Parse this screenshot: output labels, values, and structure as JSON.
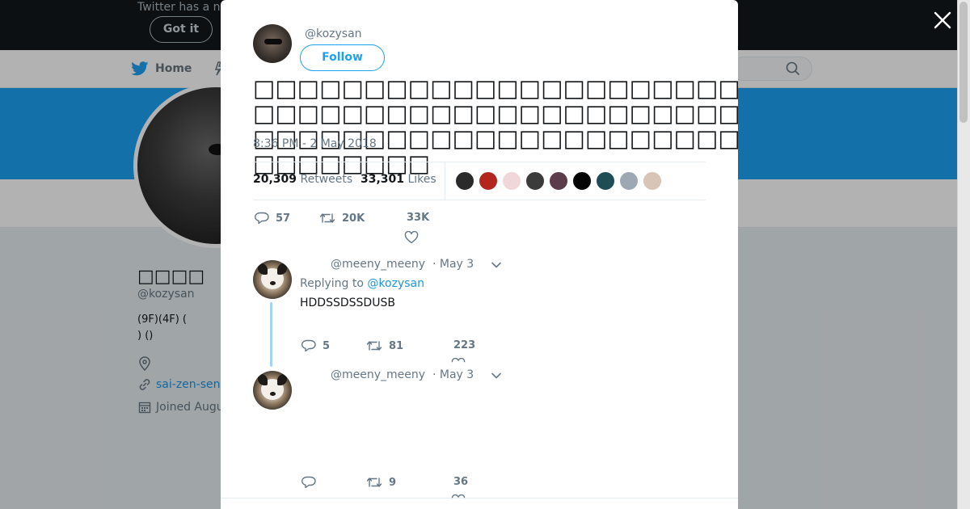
{
  "background": {
    "banner_text": "Twitter has a n",
    "got_it_label": "Got it",
    "nav_home_label": "Home",
    "profile_name": "□□□□",
    "profile_handle": "@kozysan",
    "bio_line1": "(9F)(4F) (",
    "bio_line2": ") ()",
    "website": "sai-zen-sen",
    "joined": "Joined Augu",
    "brand_color": "#1da1f2"
  },
  "modal": {
    "author": {
      "handle": "@kozysan",
      "follow_label": "Follow"
    },
    "tweet": {
      "text": "□□□□□□□□□□□□□□□□□□□□□□□□□□□□□□□□□□□□□□□□□□□□□□□□□□□□□□□□□□□□□□□□□□□□□□□□□□□□□□□□□□□□□□□□□□□□□□□□□□□□□□□□",
      "timestamp": "8:36 PM - 2 May 2018",
      "retweets_count": "20,309",
      "retweets_label": "Retweets",
      "likes_count": "33,301",
      "likes_label": "Likes",
      "reply_count": "57",
      "retweet_action_count": "20K",
      "like_action_count": "33K"
    },
    "likers": [
      {
        "color": "#2a2a2a"
      },
      {
        "color": "#b3261e"
      },
      {
        "color": "#f1d7d9"
      },
      {
        "color": "#3b3b3b"
      },
      {
        "color": "#5a3c4a"
      },
      {
        "color": "#050505"
      },
      {
        "color": "#1f4d55"
      },
      {
        "color": "#9ea8b4"
      },
      {
        "color": "#d9c4b8"
      }
    ],
    "replies": [
      {
        "handle": "@meeny_meeny",
        "date": "· May 3",
        "replying_prefix": "Replying to",
        "replying_to": "@kozysan",
        "text": "HDDSSDSSDUSB",
        "reply_count": "5",
        "retweet_count": "81",
        "like_count": "223"
      },
      {
        "handle": "@meeny_meeny",
        "date": "· May 3",
        "reply_count": "",
        "retweet_count": "9",
        "like_count": "36"
      }
    ]
  }
}
